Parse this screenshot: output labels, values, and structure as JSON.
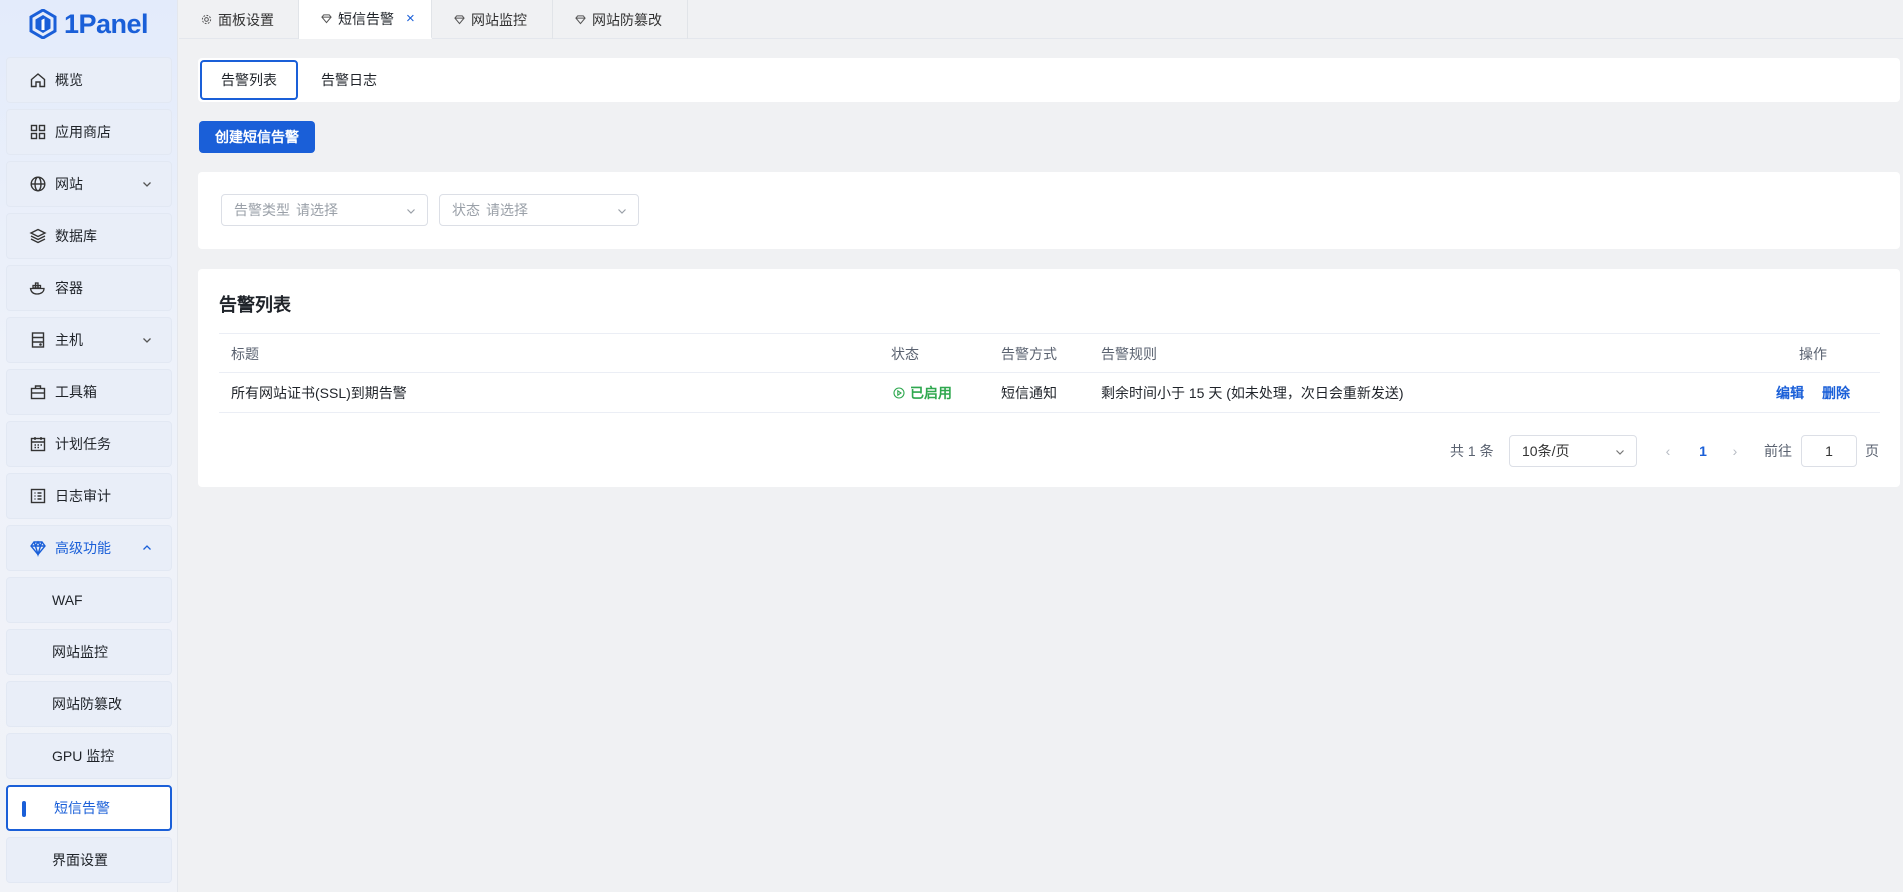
{
  "app": {
    "logo_text": "1Panel"
  },
  "sidebar": {
    "items": [
      {
        "label": "概览",
        "icon": "home-icon"
      },
      {
        "label": "应用商店",
        "icon": "grid-icon"
      },
      {
        "label": "网站",
        "icon": "globe-icon",
        "chevron": "down"
      },
      {
        "label": "数据库",
        "icon": "layers-icon"
      },
      {
        "label": "容器",
        "icon": "docker-icon"
      },
      {
        "label": "主机",
        "icon": "server-icon",
        "chevron": "down"
      },
      {
        "label": "工具箱",
        "icon": "toolbox-icon"
      },
      {
        "label": "计划任务",
        "icon": "calendar-icon"
      },
      {
        "label": "日志审计",
        "icon": "log-icon"
      },
      {
        "label": "高级功能",
        "icon": "diamond-icon",
        "chevron": "up"
      }
    ],
    "sub_items": [
      {
        "label": "WAF"
      },
      {
        "label": "网站监控"
      },
      {
        "label": "网站防篡改"
      },
      {
        "label": "GPU 监控"
      },
      {
        "label": "短信告警"
      },
      {
        "label": "界面设置"
      }
    ]
  },
  "tabs": [
    {
      "label": "面板设置",
      "icon": "gear-icon"
    },
    {
      "label": "短信告警",
      "icon": "diamond-icon",
      "close": "×"
    },
    {
      "label": "网站监控",
      "icon": "diamond-icon"
    },
    {
      "label": "网站防篡改",
      "icon": "diamond-icon"
    }
  ],
  "subtabs": [
    {
      "label": "告警列表"
    },
    {
      "label": "告警日志"
    }
  ],
  "create_button": "创建短信告警",
  "filters": [
    {
      "label": "告警类型",
      "placeholder": "请选择"
    },
    {
      "label": "状态",
      "placeholder": "请选择"
    }
  ],
  "table": {
    "title": "告警列表",
    "headers": {
      "title": "标题",
      "status": "状态",
      "method": "告警方式",
      "rule": "告警规则",
      "ops": "操作"
    },
    "rows": [
      {
        "title": "所有网站证书(SSL)到期告警",
        "status": "已启用",
        "method": "短信通知",
        "rule": "剩余时间小于 15 天 (如未处理，次日会重新发送)",
        "edit": "编辑",
        "delete": "删除"
      }
    ]
  },
  "pagination": {
    "total": "共 1 条",
    "page_size": "10条/页",
    "prev": "‹",
    "next": "›",
    "current": "1",
    "goto_label": "前往",
    "goto_value": "1",
    "unit": "页"
  },
  "colors": {
    "accent": "#1a5fd8",
    "success": "#2fa84f"
  }
}
